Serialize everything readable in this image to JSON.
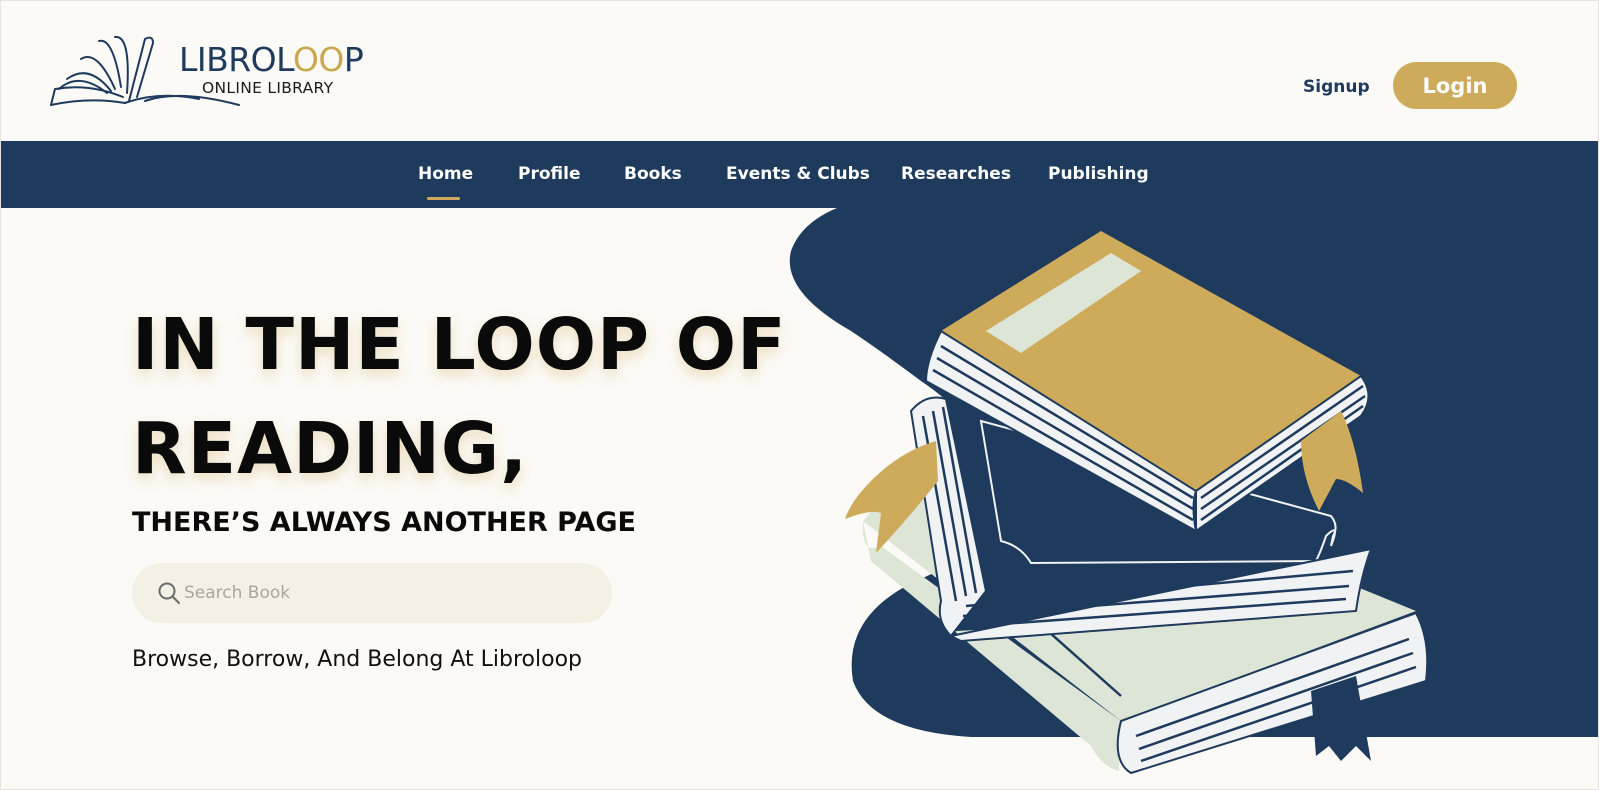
{
  "brand": {
    "name_part1": "LIBROL",
    "name_part2": "OO",
    "name_part3": "P",
    "tagline": "ONLINE LIBRARY"
  },
  "header": {
    "signup_label": "Signup",
    "login_label": "Login"
  },
  "nav": {
    "items": [
      {
        "label": "Home",
        "active": true
      },
      {
        "label": "Profile"
      },
      {
        "label": "Books"
      },
      {
        "label": "Events & Clubs"
      },
      {
        "label": "Researches"
      },
      {
        "label": "Publishing"
      }
    ]
  },
  "hero": {
    "headline_line1": "IN THE LOOP OF",
    "headline_line2": "READING,",
    "subheadline": "THERE’S ALWAYS ANOTHER PAGE",
    "search_placeholder": "Search Book",
    "tagline": "Browse, Borrow, And Belong At Libroloop"
  },
  "colors": {
    "navy": "#1e3a5c",
    "gold": "#cdab5a",
    "cream": "#fcfaf6",
    "sage": "#dde5d6"
  },
  "icons": {
    "logo": "open-book-icon",
    "search": "search-icon",
    "illustration": "book-stack-illustration"
  }
}
